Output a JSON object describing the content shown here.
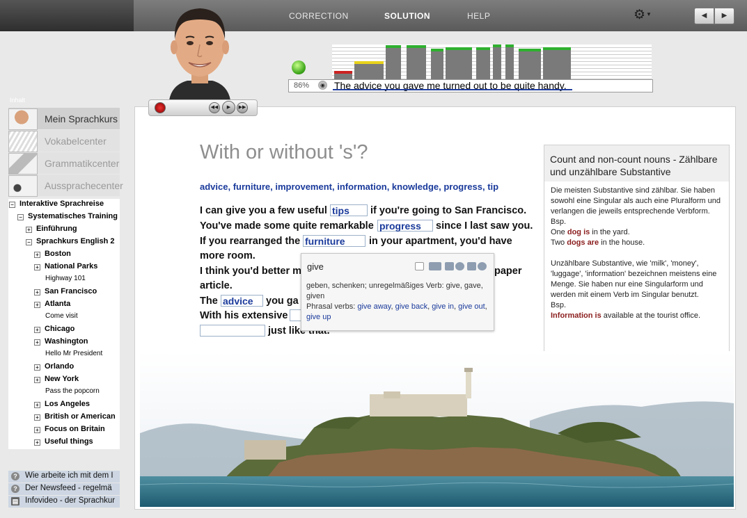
{
  "toolbar": {
    "tabs": [
      {
        "label": "CORRECTION"
      },
      {
        "label": "SOLUTION"
      },
      {
        "label": "HELP"
      }
    ],
    "gear_icon": "gear-icon",
    "prev_icon": "◀",
    "next_icon": "▶"
  },
  "player": {
    "percent": "86%",
    "phrase": "The advice you gave me turned out to be quite handy."
  },
  "sidebar": {
    "heading": "Inhalt",
    "modules": [
      {
        "label": "Mein Sprachkurs"
      },
      {
        "label": "Vokabelcenter"
      },
      {
        "label": "Grammatikcenter"
      },
      {
        "label": "Aussprachecenter"
      }
    ],
    "tree": [
      {
        "label": "Interaktive Sprachreise"
      },
      {
        "label": "Systematisches Training"
      },
      {
        "label": "Einführung"
      },
      {
        "label": "Sprachkurs English 2"
      },
      {
        "label": "Boston"
      },
      {
        "label": "National Parks"
      },
      {
        "label": "Highway 101"
      },
      {
        "label": "San Francisco"
      },
      {
        "label": "Atlanta"
      },
      {
        "label": "Come visit"
      },
      {
        "label": "Chicago"
      },
      {
        "label": "Washington"
      },
      {
        "label": "Hello Mr President"
      },
      {
        "label": "Orlando"
      },
      {
        "label": "New York"
      },
      {
        "label": "Pass the popcorn"
      },
      {
        "label": "Los Angeles"
      },
      {
        "label": "British or American"
      },
      {
        "label": "Focus on Britain"
      },
      {
        "label": "Useful things"
      }
    ],
    "help_items": [
      {
        "label": "Wie arbeite ich mit dem I"
      },
      {
        "label": "Der Newsfeed - regelmä"
      },
      {
        "label": "Infovideo - der Sprachkur"
      }
    ]
  },
  "lesson": {
    "title": "With or without 's'?",
    "word_bank": "advice, furniture, improvement, information, knowledge, progress, tip",
    "lines": [
      {
        "before": "I can give you a few useful",
        "gap": "tips",
        "after": "if you're going to San Francisco."
      },
      {
        "before": "You've made some quite remarkable",
        "gap": "progress",
        "after": "since I last saw you."
      },
      {
        "before": "If you rearranged the",
        "gap": "furniture",
        "after": "in your apartment, you'd have"
      },
      {
        "text": "more room."
      },
      {
        "text": "I think you'd better m",
        "tail": "paper"
      },
      {
        "text": "article."
      },
      {
        "before": "The",
        "gap": "advice",
        "after": "you ga"
      },
      {
        "text": "With his extensive"
      },
      {
        "gap": "",
        "after": "just like that."
      }
    ]
  },
  "popup": {
    "word": "give",
    "definition": "geben, schenken; unregelmäßiges Verb: give, gave, given",
    "phrasal_label": "Phrasal verbs:",
    "links": [
      "give away",
      "give back",
      "give in",
      "give out",
      "give up"
    ]
  },
  "info": {
    "title": "Count and non-count nouns - Zählbare und unzählbare Substantive",
    "p1": "Die meisten Substantive sind zählbar. Sie haben sowohl eine Singular als auch eine Pluralform und verlangen die jeweils entsprechende Verbform.",
    "bsp": "Bsp.",
    "ex1_pre": "One ",
    "ex1_bold": "dog is",
    "ex1_post": " in the yard.",
    "ex2_pre": "Two ",
    "ex2_bold": "dogs are",
    "ex2_post": " in the house.",
    "p2": "Unzählbare Substantive, wie 'milk', 'money', 'luggage', 'information' bezeichnen meistens eine Menge. Sie haben nur eine Singularform und werden mit einem Verb im Singular benutzt.",
    "ex3_bold": "Information is",
    "ex3_post": " available at the tourist office."
  },
  "meter": {
    "levels": [
      0.24,
      0.52,
      0.98,
      0.98,
      0.88,
      0.92,
      0.92,
      1.0,
      1.0,
      0.88,
      0.92
    ],
    "cap_colors": [
      "#cc2222",
      "#e8d21a",
      "#2fb02f",
      "#2fb02f",
      "#2fb02f",
      "#2fb02f",
      "#2fb02f",
      "#2fb02f",
      "#2fb02f",
      "#2fb02f",
      "#2fb02f"
    ]
  }
}
